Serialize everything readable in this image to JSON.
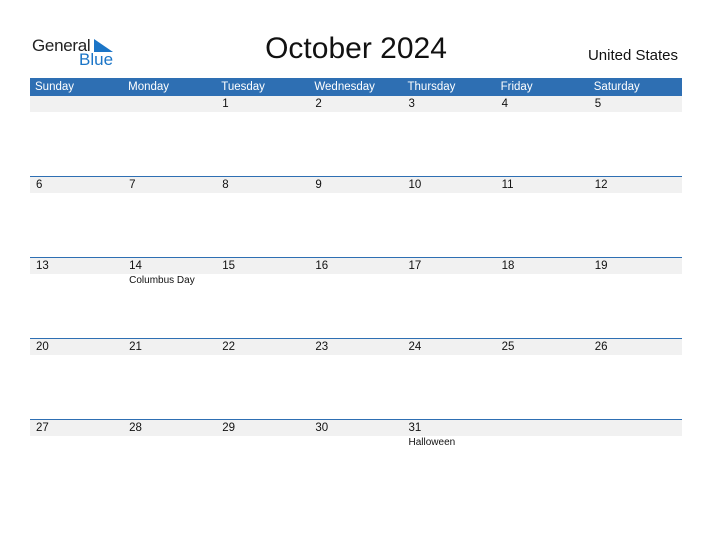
{
  "logo": {
    "word1": "General",
    "word2": "Blue"
  },
  "title": "October 2024",
  "country": "United States",
  "weekdays": [
    "Sunday",
    "Monday",
    "Tuesday",
    "Wednesday",
    "Thursday",
    "Friday",
    "Saturday"
  ],
  "weeks": [
    {
      "days": [
        "",
        "",
        "1",
        "2",
        "3",
        "4",
        "5"
      ],
      "events": [
        "",
        "",
        "",
        "",
        "",
        "",
        ""
      ]
    },
    {
      "days": [
        "6",
        "7",
        "8",
        "9",
        "10",
        "11",
        "12"
      ],
      "events": [
        "",
        "",
        "",
        "",
        "",
        "",
        ""
      ]
    },
    {
      "days": [
        "13",
        "14",
        "15",
        "16",
        "17",
        "18",
        "19"
      ],
      "events": [
        "",
        "Columbus Day",
        "",
        "",
        "",
        "",
        ""
      ]
    },
    {
      "days": [
        "20",
        "21",
        "22",
        "23",
        "24",
        "25",
        "26"
      ],
      "events": [
        "",
        "",
        "",
        "",
        "",
        "",
        ""
      ]
    },
    {
      "days": [
        "27",
        "28",
        "29",
        "30",
        "31",
        "",
        ""
      ],
      "events": [
        "",
        "",
        "",
        "",
        "Halloween",
        "",
        ""
      ]
    }
  ],
  "colors": {
    "header": "#2e6fb3",
    "brand_blue": "#1b75c7",
    "day_row_bg": "#f1f1f1"
  }
}
